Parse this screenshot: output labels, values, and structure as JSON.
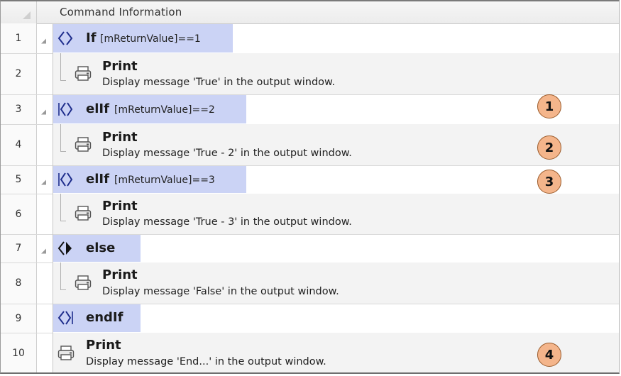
{
  "header": {
    "column_title": "Command Information"
  },
  "rows": [
    {
      "num": "1",
      "keyword": "If",
      "condition": "[mReturnValue]==1"
    },
    {
      "num": "2",
      "title": "Print",
      "message": "Display message 'True' in the output window."
    },
    {
      "num": "3",
      "keyword": "elIf",
      "condition": "[mReturnValue]==2"
    },
    {
      "num": "4",
      "title": "Print",
      "message": "Display message 'True - 2' in the output window."
    },
    {
      "num": "5",
      "keyword": "elIf",
      "condition": "[mReturnValue]==3"
    },
    {
      "num": "6",
      "title": "Print",
      "message": "Display message 'True - 3' in the output window."
    },
    {
      "num": "7",
      "keyword": "else",
      "condition": ""
    },
    {
      "num": "8",
      "title": "Print",
      "message": "Display message 'False' in the output window."
    },
    {
      "num": "9",
      "keyword": "endIf",
      "condition": ""
    },
    {
      "num": "10",
      "title": "Print",
      "message": "Display message 'End...' in the output window."
    }
  ],
  "badges": [
    "1",
    "2",
    "3",
    "4"
  ],
  "colors": {
    "condition_highlight": "#cbd3f5",
    "badge_fill": "#f4b58b",
    "badge_border": "#9a5a2a"
  }
}
